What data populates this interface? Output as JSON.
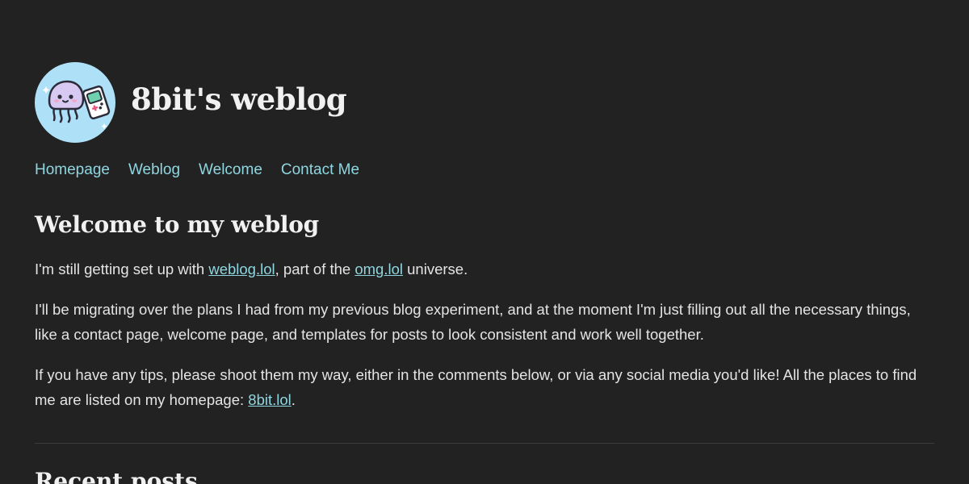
{
  "site": {
    "title": "8bit's weblog",
    "avatar_icon": "jellyfish-gameboy-icon",
    "avatar_bg": "#aee1f7"
  },
  "nav": {
    "items": [
      {
        "label": "Homepage"
      },
      {
        "label": "Weblog"
      },
      {
        "label": "Welcome"
      },
      {
        "label": "Contact Me"
      }
    ]
  },
  "post": {
    "title": "Welcome to my weblog",
    "p1": {
      "before": "I'm still getting set up with ",
      "link1": "weblog.lol",
      "middle": ", part of the ",
      "link2": "omg.lol",
      "after": " universe."
    },
    "p2": "I'll be migrating over the plans I had from my previous blog experiment, and at the moment I'm just filling out all the necessary things, like a contact page, welcome page, and templates for posts to look consistent and work well together.",
    "p3": {
      "before": "If you have any tips, please shoot them my way, either in the comments below, or via any social media you'd like! All the places to find me are listed on my homepage: ",
      "link": "8bit.lol",
      "after": "."
    }
  },
  "recent": {
    "title": "Recent posts"
  },
  "colors": {
    "background": "#222222",
    "link": "#8fd6e0",
    "text": "#e4e4e4"
  }
}
